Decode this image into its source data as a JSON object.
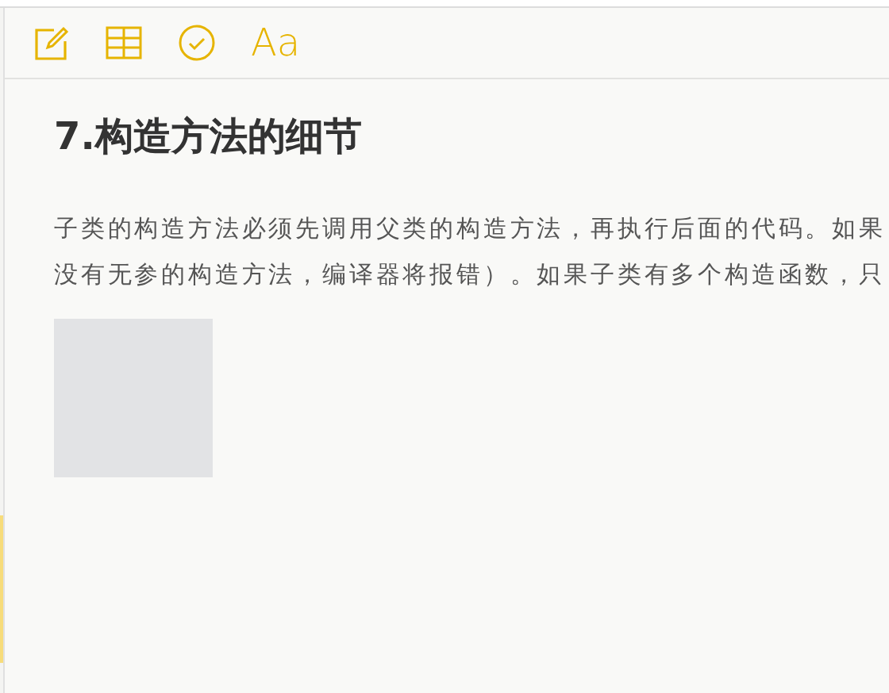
{
  "toolbar": {
    "format_label": "Aa"
  },
  "note": {
    "title": "7.构造方法的细节",
    "lines": [
      "子类的构造方法必须先调用父类的构造方法，再执行后面的代码。如果",
      "没有无参的构造方法，编译器将报错）。如果子类有多个构造函数，只"
    ],
    "attachment": {
      "kind": "placeholder"
    }
  }
}
